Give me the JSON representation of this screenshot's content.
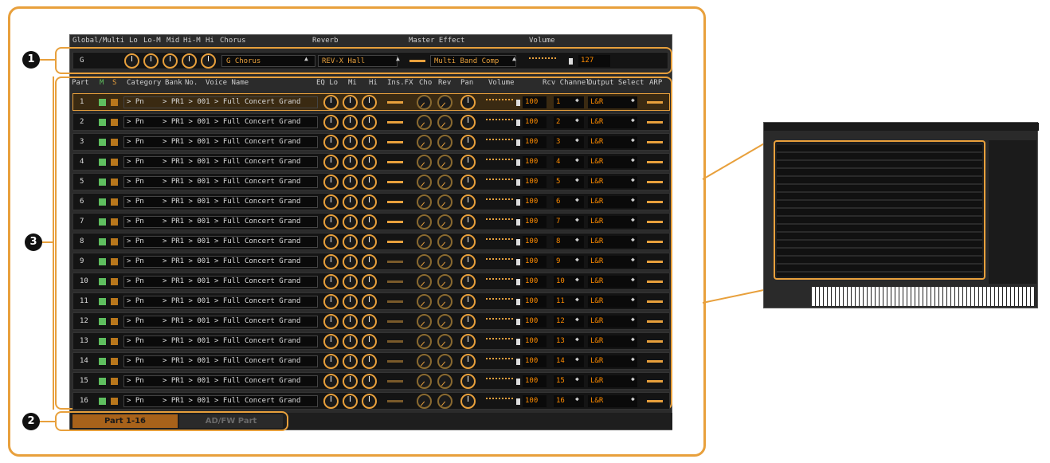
{
  "header": {
    "global_multi": "Global/Multi",
    "lo": "Lo",
    "lo_m": "Lo-M",
    "mid": "Mid",
    "hi_m": "Hi-M",
    "hi": "Hi",
    "chorus": "Chorus",
    "reverb": "Reverb",
    "master_effect": "Master Effect",
    "volume": "Volume"
  },
  "global": {
    "label": "G",
    "chorus_value": "G Chorus",
    "reverb_value": "REV-X Hall",
    "master_effect_value": "Multi Band Comp",
    "volume_value": "127"
  },
  "columns": {
    "part": "Part",
    "m": "M",
    "s": "S",
    "category": "Category",
    "bank": "Bank",
    "no": "No.",
    "voice_name": "Voice Name",
    "eq_lo": "EQ Lo",
    "eq_mi": "Mi",
    "eq_hi": "Hi",
    "ins_fx": "Ins.FX",
    "cho": "Cho",
    "rev": "Rev",
    "pan": "Pan",
    "volume": "Volume",
    "rcv_channel": "Rcv Channel",
    "output_select": "Output Select",
    "arp": "ARP"
  },
  "parts": [
    {
      "num": "1",
      "cat": "> Pn",
      "voice": "> PR1 > 001 > Full Concert Grand",
      "vol": "100",
      "ch": "1",
      "out": "L&R"
    },
    {
      "num": "2",
      "cat": "> Pn",
      "voice": "> PR1 > 001 > Full Concert Grand",
      "vol": "100",
      "ch": "2",
      "out": "L&R"
    },
    {
      "num": "3",
      "cat": "> Pn",
      "voice": "> PR1 > 001 > Full Concert Grand",
      "vol": "100",
      "ch": "3",
      "out": "L&R"
    },
    {
      "num": "4",
      "cat": "> Pn",
      "voice": "> PR1 > 001 > Full Concert Grand",
      "vol": "100",
      "ch": "4",
      "out": "L&R"
    },
    {
      "num": "5",
      "cat": "> Pn",
      "voice": "> PR1 > 001 > Full Concert Grand",
      "vol": "100",
      "ch": "5",
      "out": "L&R"
    },
    {
      "num": "6",
      "cat": "> Pn",
      "voice": "> PR1 > 001 > Full Concert Grand",
      "vol": "100",
      "ch": "6",
      "out": "L&R"
    },
    {
      "num": "7",
      "cat": "> Pn",
      "voice": "> PR1 > 001 > Full Concert Grand",
      "vol": "100",
      "ch": "7",
      "out": "L&R"
    },
    {
      "num": "8",
      "cat": "> Pn",
      "voice": "> PR1 > 001 > Full Concert Grand",
      "vol": "100",
      "ch": "8",
      "out": "L&R"
    },
    {
      "num": "9",
      "cat": "> Pn",
      "voice": "> PR1 > 001 > Full Concert Grand",
      "vol": "100",
      "ch": "9",
      "out": "L&R"
    },
    {
      "num": "10",
      "cat": "> Pn",
      "voice": "> PR1 > 001 > Full Concert Grand",
      "vol": "100",
      "ch": "10",
      "out": "L&R"
    },
    {
      "num": "11",
      "cat": "> Pn",
      "voice": "> PR1 > 001 > Full Concert Grand",
      "vol": "100",
      "ch": "11",
      "out": "L&R"
    },
    {
      "num": "12",
      "cat": "> Pn",
      "voice": "> PR1 > 001 > Full Concert Grand",
      "vol": "100",
      "ch": "12",
      "out": "L&R"
    },
    {
      "num": "13",
      "cat": "> Pn",
      "voice": "> PR1 > 001 > Full Concert Grand",
      "vol": "100",
      "ch": "13",
      "out": "L&R"
    },
    {
      "num": "14",
      "cat": "> Pn",
      "voice": "> PR1 > 001 > Full Concert Grand",
      "vol": "100",
      "ch": "14",
      "out": "L&R"
    },
    {
      "num": "15",
      "cat": "> Pn",
      "voice": "> PR1 > 001 > Full Concert Grand",
      "vol": "100",
      "ch": "15",
      "out": "L&R"
    },
    {
      "num": "16",
      "cat": "> Pn",
      "voice": "> PR1 > 001 > Full Concert Grand",
      "vol": "100",
      "ch": "16",
      "out": "L&R"
    }
  ],
  "tabs": {
    "part_1_16": "Part 1-16",
    "ad_fw_part": "AD/FW Part"
  },
  "callouts": {
    "one": "1",
    "two": "2",
    "three": "3"
  },
  "colors": {
    "accent": "#e8a03c",
    "mute": "#5fbf5f",
    "solo": "#b8771c",
    "panel": "#2b2b2b"
  }
}
